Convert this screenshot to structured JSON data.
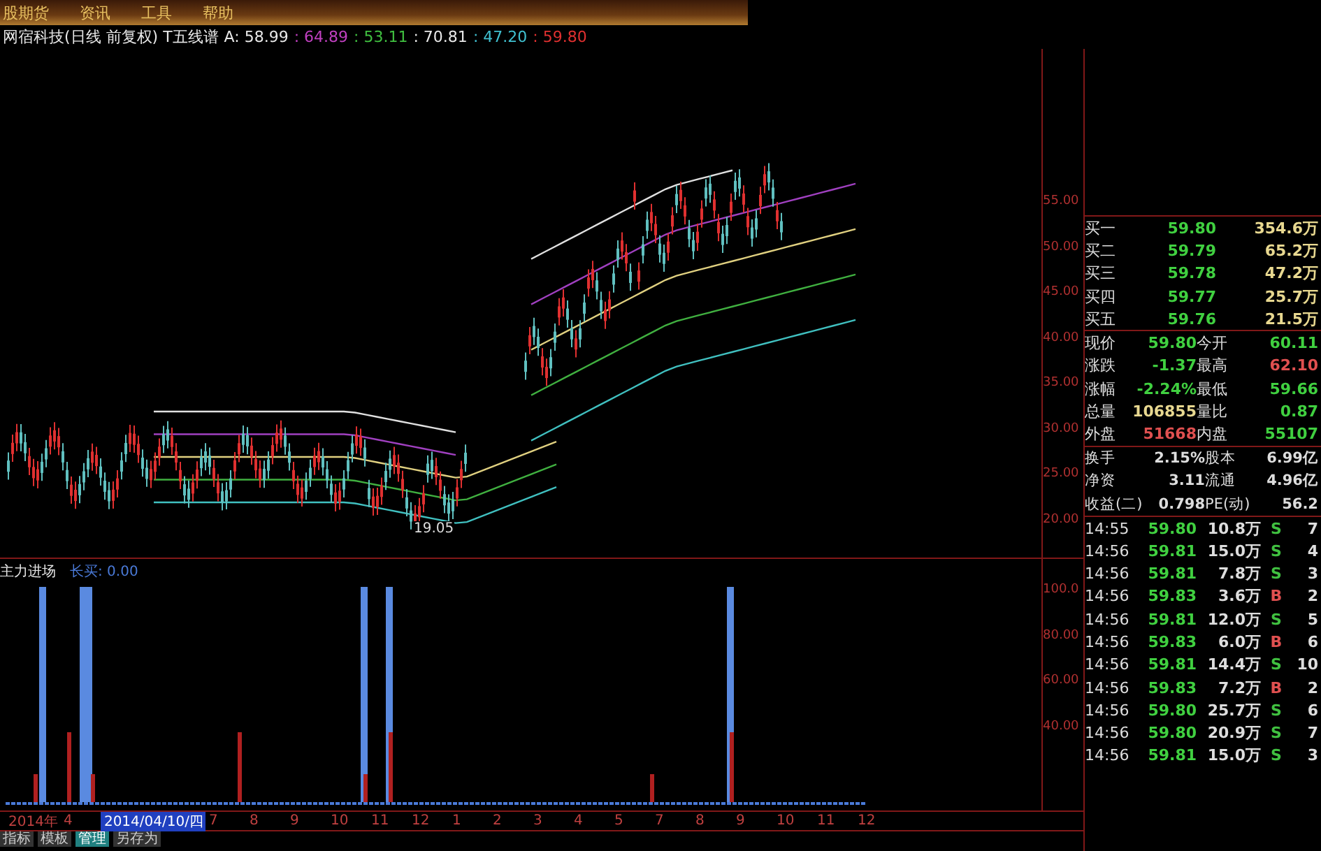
{
  "menu": [
    {
      "label": "股期货"
    },
    {
      "label": "资讯"
    },
    {
      "label": "工具"
    },
    {
      "label": "帮助"
    }
  ],
  "chart_title": {
    "name": "网宿科技(日线 前复权) T五线谱",
    "values": [
      {
        "text": "A: 58.99",
        "color": "#e8e8e8"
      },
      {
        "text": ": 64.89",
        "color": "#c040c0"
      },
      {
        "text": ": 53.11",
        "color": "#40c040"
      },
      {
        "text": ": 70.81",
        "color": "#e8e8e8"
      },
      {
        "text": ": 47.20",
        "color": "#40c0d0"
      },
      {
        "text": ": 59.80",
        "color": "#e03030"
      }
    ]
  },
  "price_axis": [
    "55.00",
    "50.00",
    "45.00",
    "40.00",
    "35.00",
    "30.00",
    "25.00",
    "20.00"
  ],
  "low_marker": "19.05",
  "indicator": {
    "name": "主力进场",
    "reading": "长买: 0.00",
    "axis": [
      "100.0",
      "80.00",
      "60.00",
      "40.00"
    ]
  },
  "quote_panel": {
    "bids": [
      {
        "label": "买一",
        "price": "59.80",
        "volume": "354.6万"
      },
      {
        "label": "买二",
        "price": "59.79",
        "volume": "65.2万"
      },
      {
        "label": "买三",
        "price": "59.78",
        "volume": "47.2万"
      },
      {
        "label": "买四",
        "price": "59.77",
        "volume": "25.7万"
      },
      {
        "label": "买五",
        "price": "59.76",
        "volume": "21.5万"
      }
    ],
    "stats": [
      {
        "label": "现价",
        "value": "59.80",
        "color": "#40d040"
      },
      {
        "label": "今开",
        "value": "60.11",
        "color": "#40d040"
      },
      {
        "label": "涨跌",
        "value": "-1.37",
        "color": "#40d040"
      },
      {
        "label": "最高",
        "value": "62.10",
        "color": "#e05050"
      },
      {
        "label": "涨幅",
        "value": "-2.24%",
        "color": "#40d040"
      },
      {
        "label": "最低",
        "value": "59.66",
        "color": "#40d040"
      },
      {
        "label": "总量",
        "value": "106855",
        "color": "#e8d890"
      },
      {
        "label": "量比",
        "value": "0.87",
        "color": "#40d040"
      },
      {
        "label": "外盘",
        "value": "51668",
        "color": "#e05050"
      },
      {
        "label": "内盘",
        "value": "55107",
        "color": "#40d040"
      }
    ],
    "fundamentals": [
      {
        "label": "换手",
        "value": "2.15%"
      },
      {
        "label": "股本",
        "value": "6.99亿"
      },
      {
        "label": "净资",
        "value": "3.11"
      },
      {
        "label": "流通",
        "value": "4.96亿"
      },
      {
        "label": "收益(二)",
        "value": "0.798"
      },
      {
        "label": "PE(动)",
        "value": "56.2"
      }
    ],
    "trades": [
      {
        "time": "14:55",
        "price": "59.80",
        "volume": "10.8万",
        "side": "S",
        "color": "#40c040",
        "count": "7"
      },
      {
        "time": "14:56",
        "price": "59.81",
        "volume": "15.0万",
        "side": "S",
        "color": "#40c040",
        "count": "4"
      },
      {
        "time": "14:56",
        "price": "59.81",
        "volume": "7.8万",
        "side": "S",
        "color": "#40c040",
        "count": "3"
      },
      {
        "time": "14:56",
        "price": "59.83",
        "volume": "3.6万",
        "side": "B",
        "color": "#e05050",
        "count": "2"
      },
      {
        "time": "14:56",
        "price": "59.81",
        "volume": "12.0万",
        "side": "S",
        "color": "#40c040",
        "count": "5"
      },
      {
        "time": "14:56",
        "price": "59.83",
        "volume": "6.0万",
        "side": "B",
        "color": "#e05050",
        "count": "6"
      },
      {
        "time": "14:56",
        "price": "59.81",
        "volume": "14.4万",
        "side": "S",
        "color": "#40c040",
        "count": "10"
      },
      {
        "time": "14:56",
        "price": "59.83",
        "volume": "7.2万",
        "side": "B",
        "color": "#e05050",
        "count": "2"
      },
      {
        "time": "14:56",
        "price": "59.80",
        "volume": "25.7万",
        "side": "S",
        "color": "#40c040",
        "count": "6"
      },
      {
        "time": "14:56",
        "price": "59.80",
        "volume": "20.9万",
        "side": "S",
        "color": "#40c040",
        "count": "7"
      },
      {
        "time": "14:56",
        "price": "59.81",
        "volume": "15.0万",
        "side": "S",
        "color": "#40c040",
        "count": "3"
      }
    ]
  },
  "date_axis": [
    {
      "label": "2014年",
      "selected": false
    },
    {
      "label": "4",
      "selected": false
    },
    {
      "label": "2014/04/10/四",
      "selected": true
    },
    {
      "label": "7",
      "selected": false
    },
    {
      "label": "8",
      "selected": false
    },
    {
      "label": "9",
      "selected": false
    },
    {
      "label": "10",
      "selected": false
    },
    {
      "label": "11",
      "selected": false
    },
    {
      "label": "12",
      "selected": false
    },
    {
      "label": "1",
      "selected": false
    },
    {
      "label": "2",
      "selected": false
    },
    {
      "label": "3",
      "selected": false
    },
    {
      "label": "4",
      "selected": false
    },
    {
      "label": "5",
      "selected": false
    },
    {
      "label": "7",
      "selected": false
    },
    {
      "label": "8",
      "selected": false
    },
    {
      "label": "9",
      "selected": false
    },
    {
      "label": "10",
      "selected": false
    },
    {
      "label": "11",
      "selected": false
    },
    {
      "label": "12",
      "selected": false
    }
  ],
  "bottom_tabs": [
    {
      "label": "指标",
      "selected": false
    },
    {
      "label": "模板",
      "selected": false
    },
    {
      "label": "管理",
      "selected": true
    },
    {
      "label": "另存为",
      "selected": false
    }
  ]
}
